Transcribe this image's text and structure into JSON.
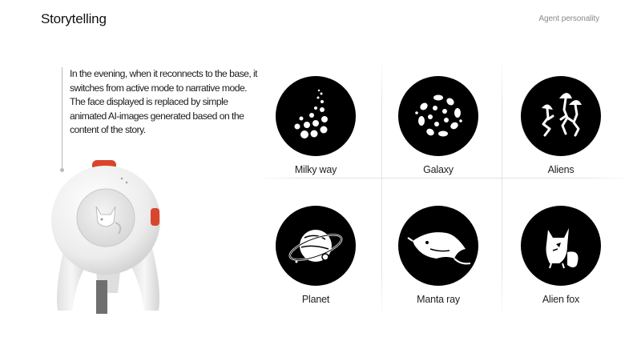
{
  "header": {
    "title": "Storytelling",
    "section": "Agent personality"
  },
  "description": "In the evening, when it reconnects to the base, it switches from active mode to narrative mode. The face displayed is replaced by simple animated AI-images generated based on the content of the story.",
  "illustrations": [
    {
      "label": "Milky way",
      "icon": "milky-way-icon"
    },
    {
      "label": "Galaxy",
      "icon": "galaxy-icon"
    },
    {
      "label": "Aliens",
      "icon": "aliens-icon"
    },
    {
      "label": "Planet",
      "icon": "planet-icon"
    },
    {
      "label": "Manta ray",
      "icon": "manta-ray-icon"
    },
    {
      "label": "Alien fox",
      "icon": "alien-fox-icon"
    }
  ],
  "colors": {
    "accent": "#d8452c",
    "icon_background": "#000000",
    "device_body": "#f2f2f2"
  }
}
